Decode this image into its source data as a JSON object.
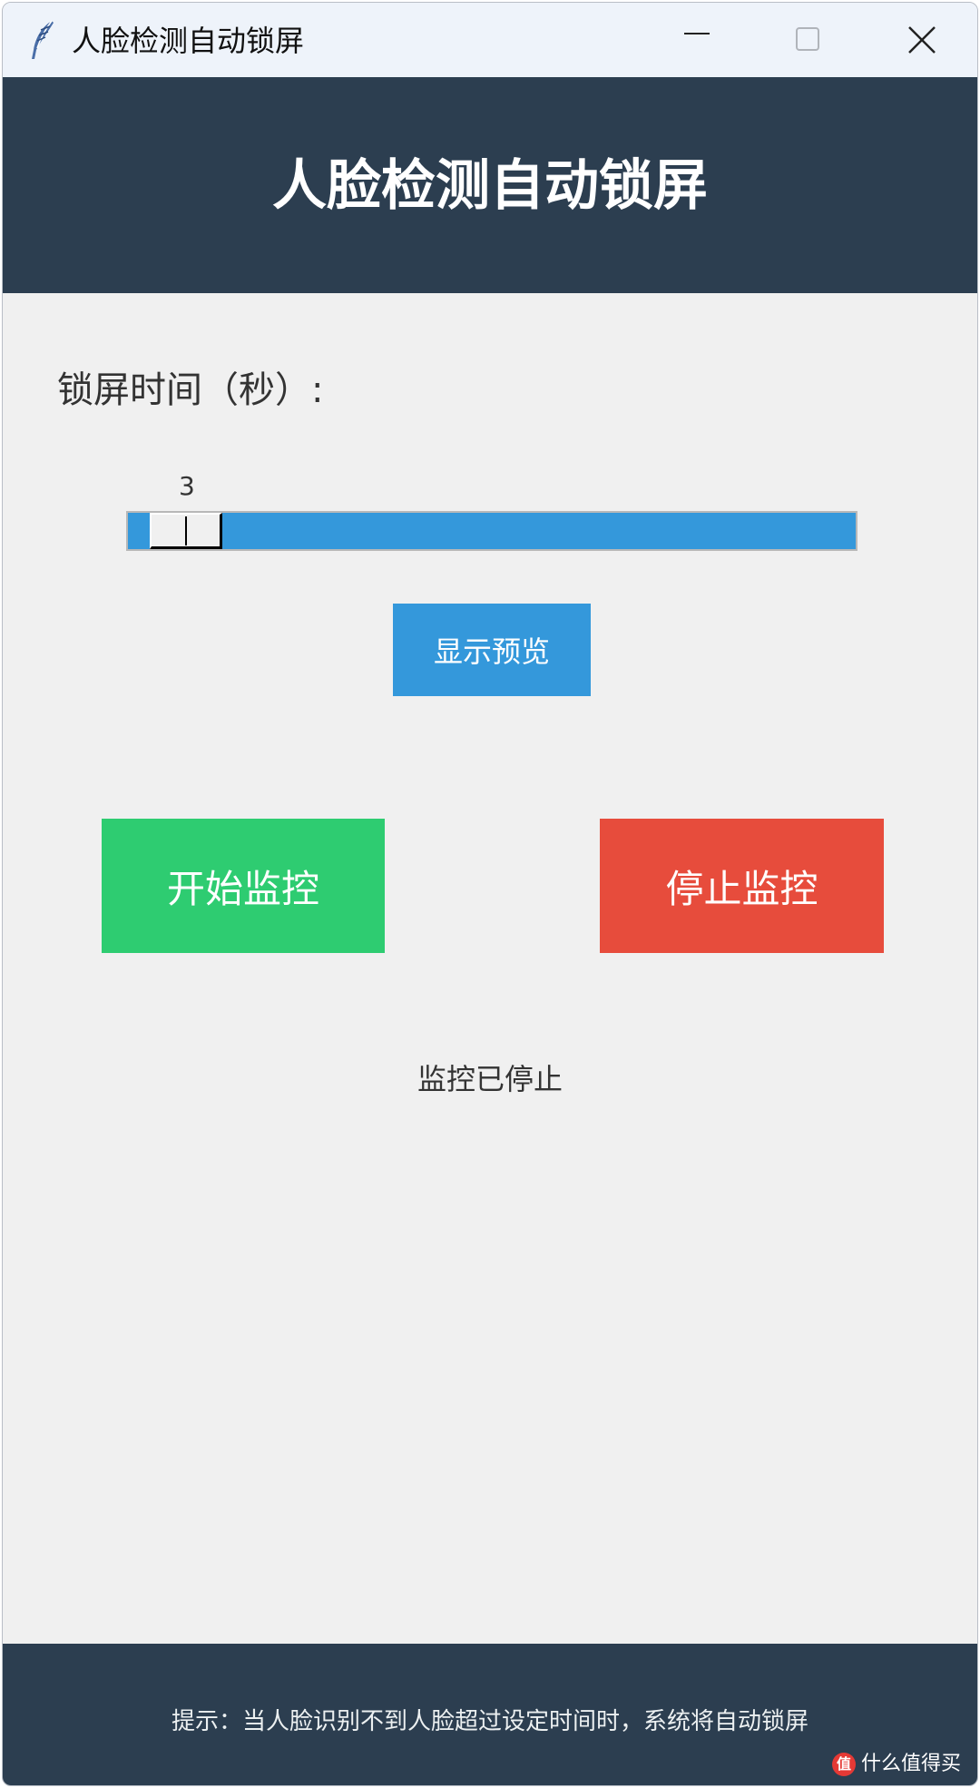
{
  "window": {
    "title": "人脸检测自动锁屏",
    "app_icon": "feather-icon",
    "controls": [
      "minimize-icon",
      "maximize-icon",
      "close-icon"
    ]
  },
  "header": {
    "title": "人脸检测自动锁屏",
    "background": "#2c3e50"
  },
  "settings": {
    "lock_time_label": "锁屏时间（秒）:",
    "slider_value": "3",
    "slider_fraction": 0.0,
    "slider_color": "#3498db"
  },
  "buttons": {
    "preview_label": "显示预览",
    "start_label": "开始监控",
    "stop_label": "停止监控",
    "start_color": "#2ecc71",
    "stop_color": "#e74c3c"
  },
  "status": {
    "text": "监控已停止"
  },
  "footer": {
    "tip": "提示：当人脸识别不到人脸超过设定时间时，系统将自动锁屏"
  },
  "watermark": {
    "badge": "值",
    "text": "什么值得买"
  }
}
